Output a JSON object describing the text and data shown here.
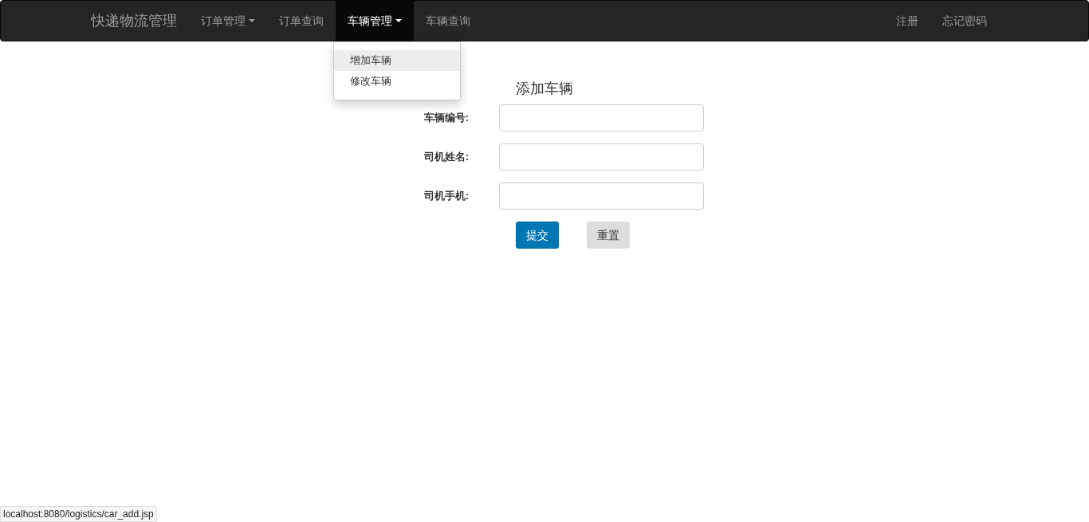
{
  "navbar": {
    "brand": "快递物流管理",
    "items": [
      {
        "label": "订单管理",
        "dropdown": true,
        "selected": false
      },
      {
        "label": "订单查询",
        "dropdown": false,
        "selected": false
      },
      {
        "label": "车辆管理",
        "dropdown": true,
        "selected": true
      },
      {
        "label": "车辆查询",
        "dropdown": false,
        "selected": false
      }
    ],
    "right_items": [
      "注册",
      "忘记密码"
    ]
  },
  "dropdown_menu": {
    "items": [
      {
        "label": "增加车辆",
        "selected": true
      },
      {
        "label": "修改车辆",
        "selected": false
      }
    ]
  },
  "form": {
    "title": "添加车辆",
    "fields": [
      {
        "label": "车辆编号:"
      },
      {
        "label": "司机姓名:"
      },
      {
        "label": "司机手机:"
      }
    ],
    "buttons": [
      {
        "label": "提交",
        "kind": "primary"
      },
      {
        "label": "重置",
        "kind": "default"
      }
    ]
  },
  "status_bar": {
    "url": "localhost:8080/logistics/car_add.jsp"
  }
}
